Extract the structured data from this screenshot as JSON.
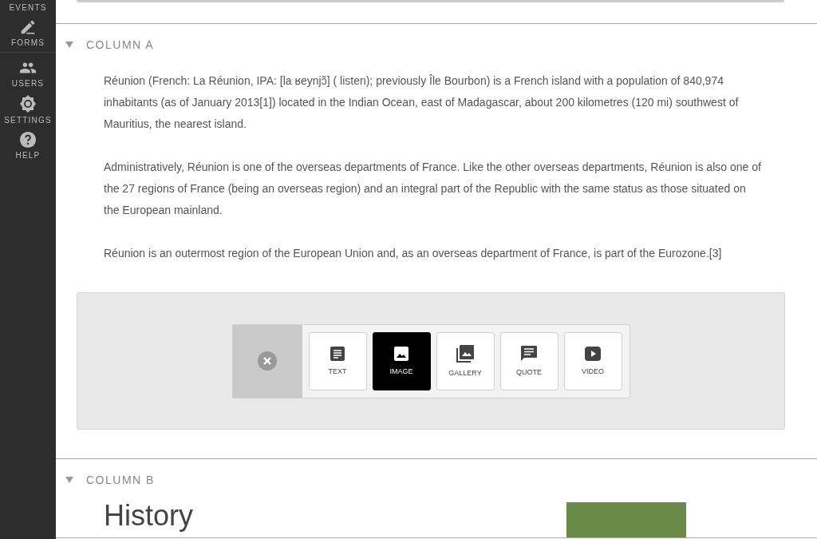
{
  "sidebar": {
    "groups": [
      [
        {
          "label": "EVENTS",
          "kind": "none"
        },
        {
          "label": "FORMS",
          "kind": "pencil"
        }
      ],
      [
        {
          "label": "USERS",
          "kind": "people"
        },
        {
          "label": "SETTINGS",
          "kind": "gear"
        },
        {
          "label": "HELP",
          "kind": "help"
        }
      ]
    ]
  },
  "columns": [
    {
      "title": "COLUMN A",
      "expanded": true,
      "paragraphs": [
        "Réunion (French: La Réunion, IPA: [la ʁeynjɔ̃] ( listen); previously Île Bourbon) is a French island with a population of 840,974 inhabitants (as of January 2013[1]) located in the Indian Ocean, east of Madagascar, about 200 kilometres (120 mi) southwest of Mauritius, the nearest island.",
        "Administratively, Réunion is one of the overseas departments of France. Like the other overseas departments, Réunion is also one of the 27 regions of France (being an overseas region) and an integral part of the Republic with the same status as those situated on the European mainland.",
        "Réunion is an outermost region of the European Union and, as an overseas department of France, is part of the Eurozone.[3]"
      ],
      "block_picker": {
        "options": [
          {
            "label": "TEXT",
            "kind": "text",
            "selected": false
          },
          {
            "label": "IMAGE",
            "kind": "image",
            "selected": true
          },
          {
            "label": "GALLERY",
            "kind": "gallery",
            "selected": false
          },
          {
            "label": "QUOTE",
            "kind": "quote",
            "selected": false
          },
          {
            "label": "VIDEO",
            "kind": "video",
            "selected": false
          }
        ]
      }
    },
    {
      "title": "COLUMN B",
      "expanded": true,
      "heading": "History"
    }
  ]
}
